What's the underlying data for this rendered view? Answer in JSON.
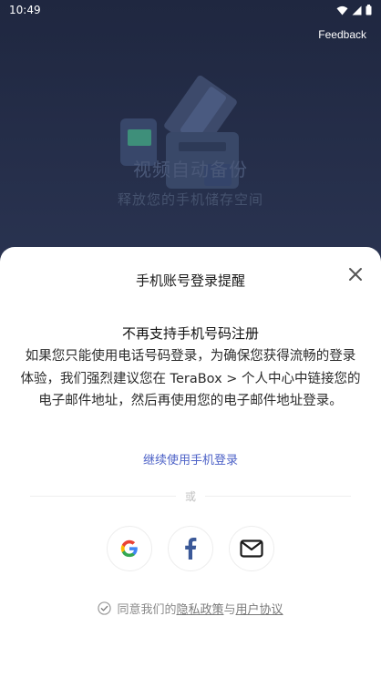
{
  "status_bar": {
    "time": "10:49",
    "icons": [
      "wifi-icon",
      "signal-icon",
      "battery-icon"
    ]
  },
  "header": {
    "feedback_label": "Feedback"
  },
  "hero": {
    "title": "视频自动备份",
    "subtitle": "释放您的手机储存空间"
  },
  "sheet": {
    "title": "手机账号登录提醒",
    "close_icon": "close-icon",
    "notice_heading": "不再支持手机号码注册",
    "notice_body": "如果您只能使用电话号码登录，为确保您获得流畅的登录体验，我们强烈建议您在 TeraBox > 个人中心中链接您的电子邮件地址，然后再使用您的电子邮件地址登录。",
    "phone_login_link": "继续使用手机登录",
    "divider_text": "或",
    "social_logins": [
      {
        "provider": "google",
        "icon": "google-icon"
      },
      {
        "provider": "facebook",
        "icon": "facebook-icon"
      },
      {
        "provider": "email",
        "icon": "mail-icon"
      }
    ],
    "agreement": {
      "prefix": "同意我们的",
      "privacy_link": "隐私政策",
      "conjunction": "与",
      "terms_link": "用户协议"
    }
  },
  "colors": {
    "link_blue": "#4d62c7",
    "facebook_blue": "#3b5998",
    "backdrop": "#2a3348"
  }
}
